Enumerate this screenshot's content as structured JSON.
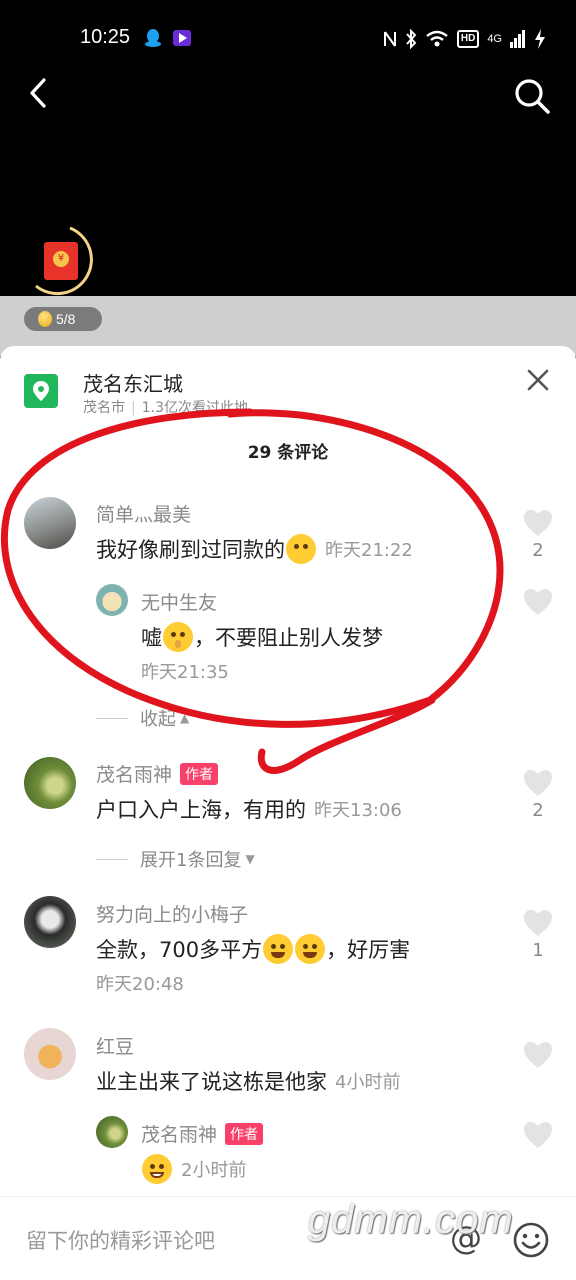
{
  "status_bar": {
    "time": "10:25",
    "network": "4G"
  },
  "red_packet": {
    "progress": "5/8"
  },
  "location": {
    "name": "茂名东汇城",
    "city": "茂名市",
    "views": "1.3亿次看过此地"
  },
  "comments_header": {
    "count_text": "29 条评论"
  },
  "comments": [
    {
      "nickname": "简单灬最美",
      "text": "我好像刷到过同款的",
      "time": "昨天21:22",
      "likes": "2"
    },
    {
      "nickname": "茂名雨神",
      "author_tag": "作者",
      "text": "户口入户上海，有用的",
      "time": "昨天13:06",
      "likes": "2",
      "expand": "展开1条回复"
    },
    {
      "nickname": "努力向上的小梅子",
      "text": "全款，700多平方",
      "text_after": "，好厉害",
      "time": "昨天20:48",
      "likes": "1"
    },
    {
      "nickname": "红豆",
      "text": "业主出来了说这栋是他家",
      "time": "4小时前"
    }
  ],
  "replies": [
    {
      "nickname": "无中生友",
      "text_before": "嘘",
      "text_after": "，不要阻止别人发梦",
      "time": "昨天21:35",
      "collapse": "收起"
    },
    {
      "nickname": "茂名雨神",
      "author_tag": "作者",
      "time": "2小时前"
    }
  ],
  "input": {
    "placeholder": "留下你的精彩评论吧",
    "at_symbol": "@"
  },
  "watermark": "gdmm.com",
  "colors": {
    "author_tag": "#f7406a",
    "location_icon": "#21b65c",
    "annotation": "#e0141c"
  }
}
